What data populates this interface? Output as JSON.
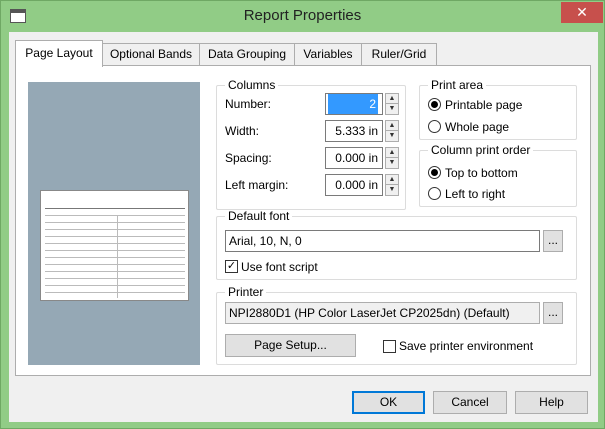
{
  "window": {
    "title": "Report Properties",
    "close": "✕"
  },
  "tabs": [
    "Page Layout",
    "Optional Bands",
    "Data Grouping",
    "Variables",
    "Ruler/Grid"
  ],
  "columns": {
    "legend": "Columns",
    "number_label": "Number:",
    "number_value": "2",
    "width_label": "Width:",
    "width_value": "5.333 in",
    "spacing_label": "Spacing:",
    "spacing_value": "0.000 in",
    "left_margin_label": "Left margin:",
    "left_margin_value": "0.000 in"
  },
  "print_area": {
    "legend": "Print area",
    "printable": "Printable page",
    "whole": "Whole page",
    "selected": "printable"
  },
  "column_order": {
    "legend": "Column print order",
    "top_bottom": "Top to bottom",
    "left_right": "Left to right",
    "selected": "top_bottom"
  },
  "default_font": {
    "legend": "Default font",
    "value": "Arial, 10, N, 0",
    "browse": "...",
    "use_script_label": "Use font script",
    "use_script_checked": true
  },
  "printer": {
    "legend": "Printer",
    "value": "NPI2880D1 (HP Color LaserJet CP2025dn) (Default)",
    "browse": "...",
    "setup_label": "Page Setup...",
    "save_env_label": "Save printer environment",
    "save_env_checked": false
  },
  "buttons": {
    "ok": "OK",
    "cancel": "Cancel",
    "help": "Help"
  },
  "colors": {
    "titlebar": "#91cc86",
    "close": "#c7504c",
    "preview_bg": "#95a8b5",
    "selection": "#3399ff"
  }
}
